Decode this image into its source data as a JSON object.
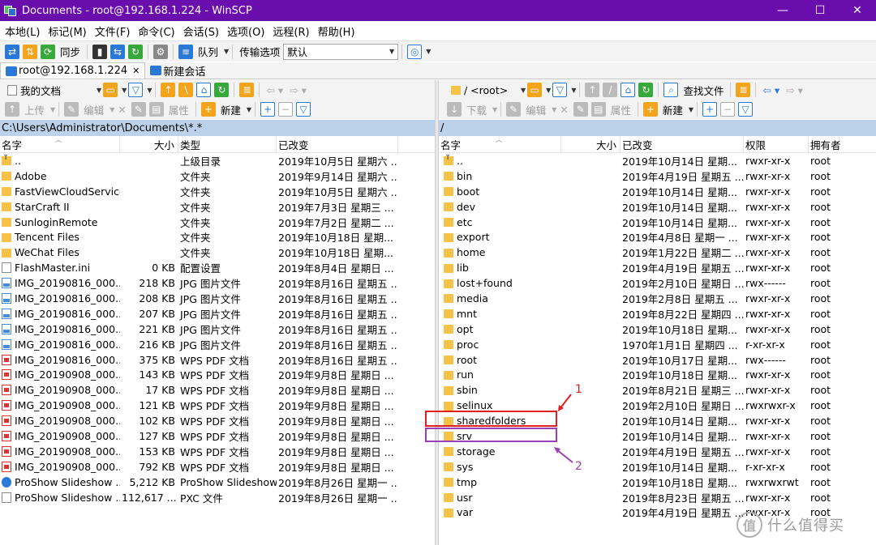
{
  "window": {
    "title": "Documents - root@192.168.1.224 - WinSCP",
    "title_color": "#6a0dad"
  },
  "menu": [
    "本地(L)",
    "标记(M)",
    "文件(F)",
    "命令(C)",
    "会话(S)",
    "选项(O)",
    "远程(R)",
    "帮助(H)"
  ],
  "toolbar": {
    "sync_label": "同步",
    "queue_label": "队列",
    "transfer_label": "传输选项",
    "transfer_value": "默认"
  },
  "tabs": [
    {
      "label": "root@192.168.1.224",
      "active": true
    },
    {
      "label": "新建会话",
      "active": false
    }
  ],
  "left": {
    "location": "我的文档",
    "upload_label": "上传",
    "edit_label": "编辑",
    "props_label": "属性",
    "new_label": "新建",
    "path": "C:\\Users\\Administrator\\Documents\\*.*",
    "columns": [
      "名字",
      "大小",
      "类型",
      "已改变"
    ],
    "rows": [
      {
        "icon": "up",
        "name": "..",
        "size": "",
        "type": "上级目录",
        "modified": "2019年10月5日 星期六 ..."
      },
      {
        "icon": "folder",
        "name": "Adobe",
        "size": "",
        "type": "文件夹",
        "modified": "2019年9月14日 星期六 ..."
      },
      {
        "icon": "folder",
        "name": "FastViewCloudService",
        "size": "",
        "type": "文件夹",
        "modified": "2019年10月5日 星期六 ..."
      },
      {
        "icon": "folder",
        "name": "StarCraft II",
        "size": "",
        "type": "文件夹",
        "modified": "2019年7月3日 星期三 ..."
      },
      {
        "icon": "folder",
        "name": "SunloginRemote",
        "size": "",
        "type": "文件夹",
        "modified": "2019年7月2日 星期二 ..."
      },
      {
        "icon": "folder",
        "name": "Tencent Files",
        "size": "",
        "type": "文件夹",
        "modified": "2019年10月18日 星期..."
      },
      {
        "icon": "folder",
        "name": "WeChat Files",
        "size": "",
        "type": "文件夹",
        "modified": "2019年10月18日 星期..."
      },
      {
        "icon": "doc",
        "name": "FlashMaster.ini",
        "size": "0 KB",
        "type": "配置设置",
        "modified": "2019年8月4日 星期日 ..."
      },
      {
        "icon": "img",
        "name": "IMG_20190816_000...",
        "size": "218 KB",
        "type": "JPG 图片文件",
        "modified": "2019年8月16日 星期五 ..."
      },
      {
        "icon": "img",
        "name": "IMG_20190816_000...",
        "size": "208 KB",
        "type": "JPG 图片文件",
        "modified": "2019年8月16日 星期五 ..."
      },
      {
        "icon": "img",
        "name": "IMG_20190816_000...",
        "size": "207 KB",
        "type": "JPG 图片文件",
        "modified": "2019年8月16日 星期五 ..."
      },
      {
        "icon": "img",
        "name": "IMG_20190816_000...",
        "size": "221 KB",
        "type": "JPG 图片文件",
        "modified": "2019年8月16日 星期五 ..."
      },
      {
        "icon": "img",
        "name": "IMG_20190816_000...",
        "size": "216 KB",
        "type": "JPG 图片文件",
        "modified": "2019年8月16日 星期五 ..."
      },
      {
        "icon": "pdf",
        "name": "IMG_20190816_000...",
        "size": "375 KB",
        "type": "WPS PDF 文档",
        "modified": "2019年8月16日 星期五 ..."
      },
      {
        "icon": "pdf",
        "name": "IMG_20190908_000...",
        "size": "143 KB",
        "type": "WPS PDF 文档",
        "modified": "2019年9月8日 星期日 ..."
      },
      {
        "icon": "pdf",
        "name": "IMG_20190908_000...",
        "size": "17 KB",
        "type": "WPS PDF 文档",
        "modified": "2019年9月8日 星期日 ..."
      },
      {
        "icon": "pdf",
        "name": "IMG_20190908_000...",
        "size": "121 KB",
        "type": "WPS PDF 文档",
        "modified": "2019年9月8日 星期日 ..."
      },
      {
        "icon": "pdf",
        "name": "IMG_20190908_000...",
        "size": "102 KB",
        "type": "WPS PDF 文档",
        "modified": "2019年9月8日 星期日 ..."
      },
      {
        "icon": "pdf",
        "name": "IMG_20190908_000...",
        "size": "127 KB",
        "type": "WPS PDF 文档",
        "modified": "2019年9月8日 星期日 ..."
      },
      {
        "icon": "pdf",
        "name": "IMG_20190908_000...",
        "size": "153 KB",
        "type": "WPS PDF 文档",
        "modified": "2019年9月8日 星期日 ..."
      },
      {
        "icon": "pdf",
        "name": "IMG_20190908_000...",
        "size": "792 KB",
        "type": "WPS PDF 文档",
        "modified": "2019年9月8日 星期日 ..."
      },
      {
        "icon": "pro",
        "name": "ProShow Slideshow ...",
        "size": "5,212 KB",
        "type": "ProShow Slideshow",
        "modified": "2019年8月26日 星期一 ..."
      },
      {
        "icon": "doc",
        "name": "ProShow Slideshow ...",
        "size": "112,617 ...",
        "type": "PXC 文件",
        "modified": "2019年8月26日 星期一 ..."
      }
    ]
  },
  "right": {
    "location": "/ <root>",
    "find_label": "查找文件",
    "download_label": "下载",
    "edit_label": "编辑",
    "props_label": "属性",
    "new_label": "新建",
    "path": "/",
    "columns": [
      "名字",
      "大小",
      "已改变",
      "权限",
      "拥有者"
    ],
    "rows": [
      {
        "icon": "up",
        "name": "..",
        "size": "",
        "modified": "2019年10月14日 星期...",
        "perm": "rwxr-xr-x",
        "owner": "root"
      },
      {
        "icon": "folder",
        "name": "bin",
        "size": "",
        "modified": "2019年4月19日 星期五 ...",
        "perm": "rwxr-xr-x",
        "owner": "root"
      },
      {
        "icon": "folder",
        "name": "boot",
        "size": "",
        "modified": "2019年10月14日 星期...",
        "perm": "rwxr-xr-x",
        "owner": "root"
      },
      {
        "icon": "folder",
        "name": "dev",
        "size": "",
        "modified": "2019年10月14日 星期...",
        "perm": "rwxr-xr-x",
        "owner": "root"
      },
      {
        "icon": "folder",
        "name": "etc",
        "size": "",
        "modified": "2019年10月14日 星期...",
        "perm": "rwxr-xr-x",
        "owner": "root"
      },
      {
        "icon": "folder",
        "name": "export",
        "size": "",
        "modified": "2019年4月8日 星期一 ...",
        "perm": "rwxr-xr-x",
        "owner": "root"
      },
      {
        "icon": "folder",
        "name": "home",
        "size": "",
        "modified": "2019年1月22日 星期二 ...",
        "perm": "rwxr-xr-x",
        "owner": "root"
      },
      {
        "icon": "folder",
        "name": "lib",
        "size": "",
        "modified": "2019年4月19日 星期五 ...",
        "perm": "rwxr-xr-x",
        "owner": "root"
      },
      {
        "icon": "folder",
        "name": "lost+found",
        "size": "",
        "modified": "2019年2月10日 星期日 ...",
        "perm": "rwx------",
        "owner": "root"
      },
      {
        "icon": "folder",
        "name": "media",
        "size": "",
        "modified": "2019年2月8日 星期五 ...",
        "perm": "rwxr-xr-x",
        "owner": "root"
      },
      {
        "icon": "folder",
        "name": "mnt",
        "size": "",
        "modified": "2019年8月22日 星期四 ...",
        "perm": "rwxr-xr-x",
        "owner": "root"
      },
      {
        "icon": "folder",
        "name": "opt",
        "size": "",
        "modified": "2019年10月18日 星期...",
        "perm": "rwxr-xr-x",
        "owner": "root"
      },
      {
        "icon": "folder",
        "name": "proc",
        "size": "",
        "modified": "1970年1月1日 星期四 ...",
        "perm": "r-xr-xr-x",
        "owner": "root"
      },
      {
        "icon": "folder",
        "name": "root",
        "size": "",
        "modified": "2019年10月17日 星期...",
        "perm": "rwx------",
        "owner": "root"
      },
      {
        "icon": "folder",
        "name": "run",
        "size": "",
        "modified": "2019年10月18日 星期...",
        "perm": "rwxr-xr-x",
        "owner": "root"
      },
      {
        "icon": "folder",
        "name": "sbin",
        "size": "",
        "modified": "2019年8月21日 星期三 ...",
        "perm": "rwxr-xr-x",
        "owner": "root"
      },
      {
        "icon": "folder",
        "name": "selinux",
        "size": "",
        "modified": "2019年2月10日 星期日 ...",
        "perm": "rwxrwxr-x",
        "owner": "root"
      },
      {
        "icon": "folder",
        "name": "sharedfolders",
        "size": "",
        "modified": "2019年10月14日 星期...",
        "perm": "rwxr-xr-x",
        "owner": "root"
      },
      {
        "icon": "folder",
        "name": "srv",
        "size": "",
        "modified": "2019年10月14日 星期...",
        "perm": "rwxr-xr-x",
        "owner": "root"
      },
      {
        "icon": "folder",
        "name": "storage",
        "size": "",
        "modified": "2019年4月19日 星期五 ...",
        "perm": "rwxr-xr-x",
        "owner": "root"
      },
      {
        "icon": "folder",
        "name": "sys",
        "size": "",
        "modified": "2019年10月14日 星期...",
        "perm": "r-xr-xr-x",
        "owner": "root"
      },
      {
        "icon": "folder",
        "name": "tmp",
        "size": "",
        "modified": "2019年10月18日 星期...",
        "perm": "rwxrwxrwt",
        "owner": "root"
      },
      {
        "icon": "folder",
        "name": "usr",
        "size": "",
        "modified": "2019年8月23日 星期五 ...",
        "perm": "rwxr-xr-x",
        "owner": "root"
      },
      {
        "icon": "folder",
        "name": "var",
        "size": "",
        "modified": "2019年4月19日 星期五 ...",
        "perm": "rwxr-xr-x",
        "owner": "root"
      }
    ]
  },
  "annotations": [
    {
      "label": "1",
      "color": "#e02020"
    },
    {
      "label": "2",
      "color": "#9b3fb5"
    }
  ],
  "watermark": {
    "logo": "值",
    "text": "什么值得买"
  }
}
